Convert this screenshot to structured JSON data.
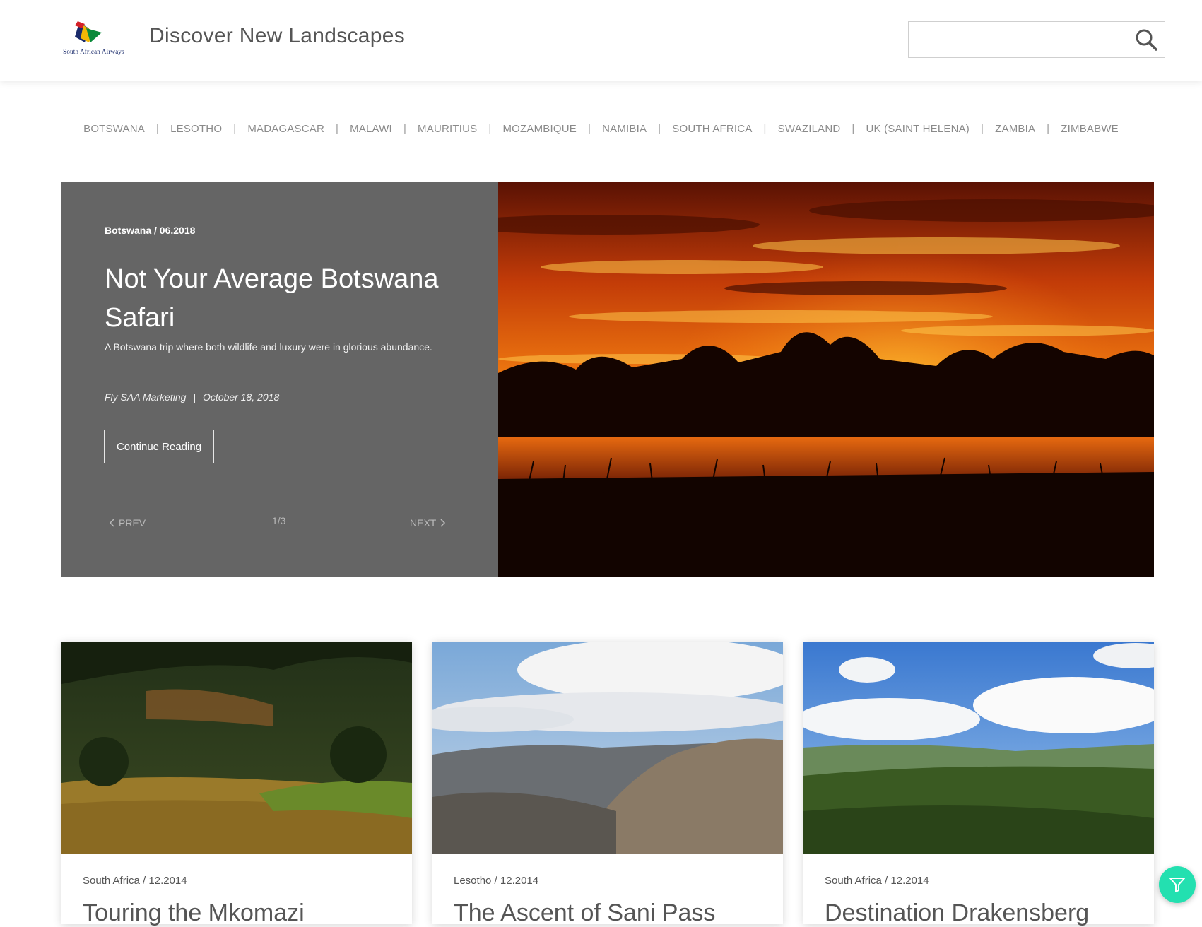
{
  "header": {
    "logo_text": "South African Airways",
    "site_title": "Discover New Landscapes",
    "search_value": "",
    "search_placeholder": ""
  },
  "countries": [
    "BOTSWANA",
    "LESOTHO",
    "MADAGASCAR",
    "MALAWI",
    "MAURITIUS",
    "MOZAMBIQUE",
    "NAMIBIA",
    "SOUTH AFRICA",
    "SWAZILAND",
    "UK (SAINT HELENA)",
    "ZAMBIA",
    "ZIMBABWE"
  ],
  "separator": "|",
  "hero": {
    "meta": "Botswana / 06.2018",
    "title": "Not Your Average Botswana Safari",
    "description": "A Botswana trip where both wildlife and luxury were in glorious abundance.",
    "author": "Fly SAA Marketing",
    "byline_sep": "|",
    "date": "October 18, 2018",
    "button_label": "Continue Reading",
    "prev_label": "PREV",
    "next_label": "NEXT",
    "page_indicator": "1/3"
  },
  "cards": [
    {
      "meta": "South Africa / 12.2014",
      "title": "Touring the Mkomazi"
    },
    {
      "meta": "Lesotho / 12.2014",
      "title": "The Ascent of Sani Pass"
    },
    {
      "meta": "South Africa / 12.2014",
      "title": "Destination Drakensberg"
    }
  ],
  "colors": {
    "hero_panel": "#656565",
    "fab": "#23e0b0",
    "nav_text": "#8a8a8a"
  },
  "icons": {
    "search": "search-icon",
    "filter": "filter-icon",
    "prev": "chevron-left-icon",
    "next": "chevron-right-icon"
  }
}
